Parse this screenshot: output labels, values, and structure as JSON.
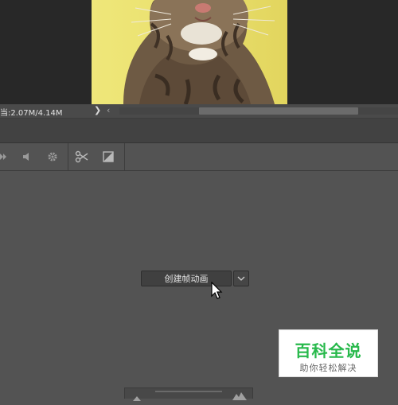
{
  "status_bar": {
    "doc_info": "当:2.07M/4.14M",
    "expand_arrow": "❯",
    "scroll_left_arrow": "‹"
  },
  "timeline": {
    "create_button_label": "创建帧动画",
    "dropdown_icon": "chevron-down-icon"
  },
  "toolbar": {
    "icons": [
      "play-icon",
      "audio-icon",
      "gear-icon",
      "scissors-icon",
      "transition-icon"
    ]
  },
  "watermark": {
    "title": "百科全说",
    "subtitle": "助你轻松解决",
    "color": "#27b94b"
  }
}
